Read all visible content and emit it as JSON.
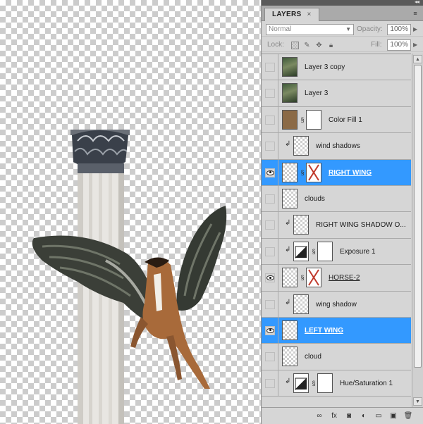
{
  "panel": {
    "tab_label": "LAYERS",
    "tab_close": "×",
    "menu_glyph": "≡",
    "collapse_glyph": "◂◂",
    "blend_mode": "Normal",
    "opacity_label": "Opacity:",
    "opacity_value": "100%",
    "lock_label": "Lock:",
    "fill_label": "Fill:",
    "fill_value": "100%"
  },
  "layers": [
    {
      "name": "Layer 3 copy",
      "visible": false,
      "selected": false,
      "clipped": false,
      "thumb": "photo",
      "mask": "none"
    },
    {
      "name": "Layer 3",
      "visible": false,
      "selected": false,
      "clipped": false,
      "thumb": "photo",
      "mask": "none"
    },
    {
      "name": "Color Fill 1",
      "visible": false,
      "selected": false,
      "clipped": false,
      "thumb": "brown",
      "mask": "white"
    },
    {
      "name": "wind shadows",
      "visible": false,
      "selected": false,
      "clipped": true,
      "thumb": "checker",
      "mask": "none"
    },
    {
      "name": "RIGHT WING",
      "visible": true,
      "selected": true,
      "clipped": false,
      "thumb": "checker",
      "mask": "x"
    },
    {
      "name": "clouds",
      "visible": false,
      "selected": false,
      "clipped": false,
      "thumb": "checker",
      "mask": "none"
    },
    {
      "name": "RIGHT WING SHADOW O...",
      "visible": false,
      "selected": false,
      "clipped": true,
      "thumb": "checker",
      "mask": "none"
    },
    {
      "name": "Exposure 1",
      "visible": false,
      "selected": false,
      "clipped": true,
      "thumb": "adj",
      "mask": "white"
    },
    {
      "name": "HORSE-2",
      "visible": true,
      "selected": false,
      "clipped": false,
      "thumb": "checker",
      "mask": "x"
    },
    {
      "name": "wing shadow",
      "visible": false,
      "selected": false,
      "clipped": true,
      "thumb": "checker",
      "mask": "none"
    },
    {
      "name": "LEFT WING",
      "visible": true,
      "selected": true,
      "clipped": false,
      "thumb": "checker",
      "mask": "none"
    },
    {
      "name": "cloud",
      "visible": false,
      "selected": false,
      "clipped": false,
      "thumb": "checker",
      "mask": "none"
    },
    {
      "name": "Hue/Saturation 1",
      "visible": false,
      "selected": false,
      "clipped": true,
      "thumb": "adj",
      "mask": "white"
    }
  ],
  "bottom_icons": [
    "link-layers-icon",
    "fx-icon",
    "add-mask-icon",
    "adjustment-layer-icon",
    "new-group-icon",
    "new-layer-icon",
    "delete-layer-icon"
  ],
  "colors": {
    "selection": "#3399ff",
    "panel_bg": "#d6d6d6"
  }
}
